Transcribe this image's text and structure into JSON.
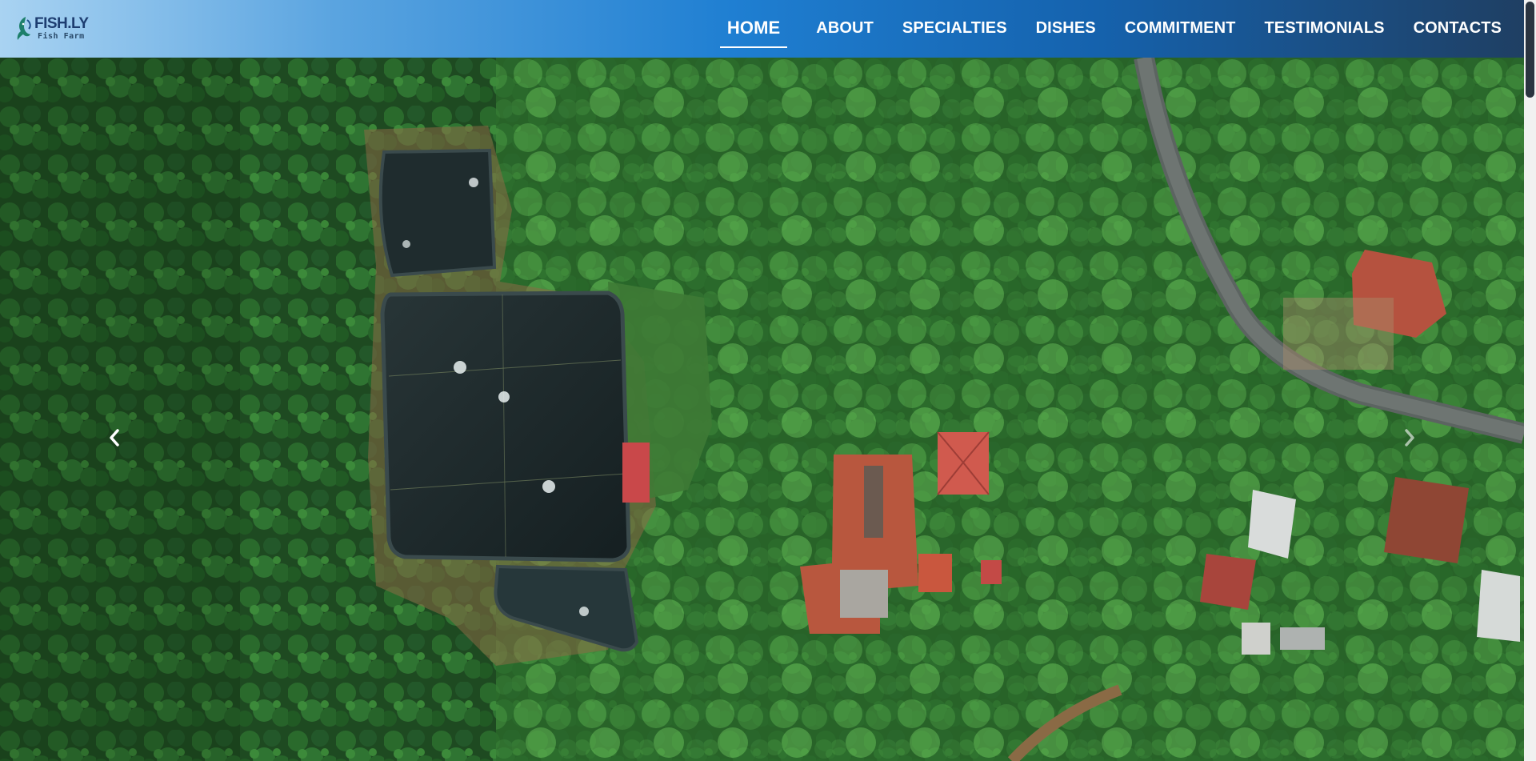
{
  "brand": {
    "name": "FISH.LY",
    "tagline": "Fish Farm",
    "icon": "fish-logo-icon"
  },
  "nav": {
    "items": [
      {
        "label": "HOME",
        "active": true
      },
      {
        "label": "ABOUT"
      },
      {
        "label": "SPECIALTIES"
      },
      {
        "label": "DISHES"
      },
      {
        "label": "COMMITMENT"
      },
      {
        "label": "TESTIMONIALS"
      },
      {
        "label": "CONTACTS"
      }
    ]
  },
  "hero": {
    "image": "aerial-fish-farm-ponds",
    "prev_icon": "chevron-left-icon",
    "next_icon": "chevron-right-icon",
    "slides_total": 2,
    "active_slide": 1
  },
  "colors": {
    "header_start": "#a9d3f2",
    "header_mid": "#1f7fd2",
    "header_end": "#1f3f63",
    "nav_text": "#ffffff",
    "brand_text": "#1d3d70",
    "forest": "#1f4d22",
    "pond": "#1b2a2c"
  }
}
